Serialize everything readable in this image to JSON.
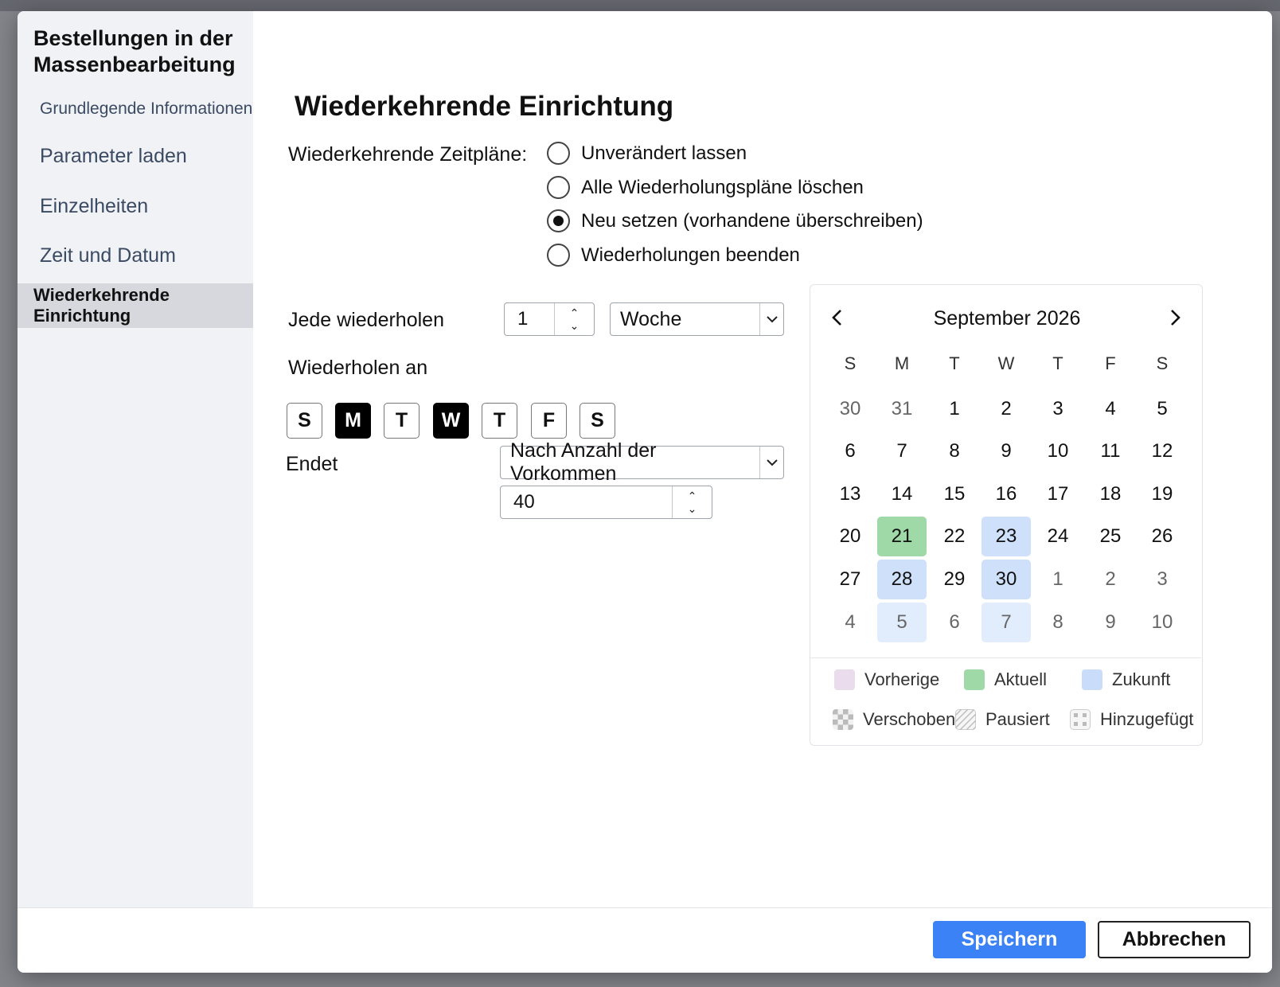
{
  "sidebar": {
    "title": "Bestellungen in der Massenbearbeitung",
    "items": [
      {
        "label": "Grundlegende Informationen"
      },
      {
        "label": "Parameter laden"
      },
      {
        "label": "Einzelheiten"
      },
      {
        "label": "Zeit und Datum"
      },
      {
        "label": "Wiederkehrende Einrichtung"
      }
    ]
  },
  "main": {
    "title": "Wiederkehrende Einrichtung",
    "schedules_label": "Wiederkehrende Zeitpläne:",
    "schedule_options": [
      {
        "label": "Unverändert lassen",
        "selected": false
      },
      {
        "label": "Alle Wiederholungspläne löschen",
        "selected": false
      },
      {
        "label": "Neu setzen (vorhandene überschreiben)",
        "selected": true
      },
      {
        "label": "Wiederholungen beenden",
        "selected": false
      }
    ],
    "repeat_every_label": "Jede wiederholen",
    "repeat_every_value": "1",
    "repeat_unit": "Woche",
    "repeat_on_label": "Wiederholen an",
    "days": [
      {
        "label": "S",
        "on": false
      },
      {
        "label": "M",
        "on": true
      },
      {
        "label": "T",
        "on": false
      },
      {
        "label": "W",
        "on": true
      },
      {
        "label": "T",
        "on": false
      },
      {
        "label": "F",
        "on": false
      },
      {
        "label": "S",
        "on": false
      }
    ],
    "ends_label": "Endet",
    "ends_mode": "Nach Anzahl der Vorkommen",
    "occurrences": "40"
  },
  "calendar": {
    "month": "September 2026",
    "weekdays": [
      "S",
      "M",
      "T",
      "W",
      "T",
      "F",
      "S"
    ],
    "weeks": [
      [
        {
          "d": "30",
          "o": 1
        },
        {
          "d": "31",
          "o": 1
        },
        {
          "d": "1"
        },
        {
          "d": "2"
        },
        {
          "d": "3"
        },
        {
          "d": "4"
        },
        {
          "d": "5"
        }
      ],
      [
        {
          "d": "6"
        },
        {
          "d": "7"
        },
        {
          "d": "8"
        },
        {
          "d": "9"
        },
        {
          "d": "10"
        },
        {
          "d": "11"
        },
        {
          "d": "12"
        }
      ],
      [
        {
          "d": "13"
        },
        {
          "d": "14"
        },
        {
          "d": "15"
        },
        {
          "d": "16"
        },
        {
          "d": "17"
        },
        {
          "d": "18"
        },
        {
          "d": "19"
        }
      ],
      [
        {
          "d": "20"
        },
        {
          "d": "21",
          "s": "current"
        },
        {
          "d": "22"
        },
        {
          "d": "23",
          "s": "future"
        },
        {
          "d": "24"
        },
        {
          "d": "25"
        },
        {
          "d": "26"
        }
      ],
      [
        {
          "d": "27"
        },
        {
          "d": "28",
          "s": "future"
        },
        {
          "d": "29"
        },
        {
          "d": "30",
          "s": "future"
        },
        {
          "d": "1",
          "o": 1
        },
        {
          "d": "2",
          "o": 1
        },
        {
          "d": "3",
          "o": 1
        }
      ],
      [
        {
          "d": "4",
          "o": 1
        },
        {
          "d": "5",
          "o": 1,
          "s": "future-light"
        },
        {
          "d": "6",
          "o": 1
        },
        {
          "d": "7",
          "o": 1,
          "s": "future-light"
        },
        {
          "d": "8",
          "o": 1
        },
        {
          "d": "9",
          "o": 1
        },
        {
          "d": "10",
          "o": 1
        }
      ]
    ],
    "legend": [
      {
        "label": "Vorherige",
        "color": "#eadcec"
      },
      {
        "label": "Aktuell",
        "color": "#9ed9a7"
      },
      {
        "label": "Zukunft",
        "color": "#c9ddfb"
      },
      {
        "label": "Verschoben",
        "pattern": "checker"
      },
      {
        "label": "Pausiert",
        "pattern": "hatch"
      },
      {
        "label": "Hinzugefügt",
        "pattern": "dots"
      }
    ]
  },
  "footer": {
    "save_label": "Speichern",
    "cancel_label": "Abbrechen"
  },
  "colors": {
    "primary": "#3b82f6",
    "current": "#9ed9a7",
    "future": "#cfe0fb"
  }
}
